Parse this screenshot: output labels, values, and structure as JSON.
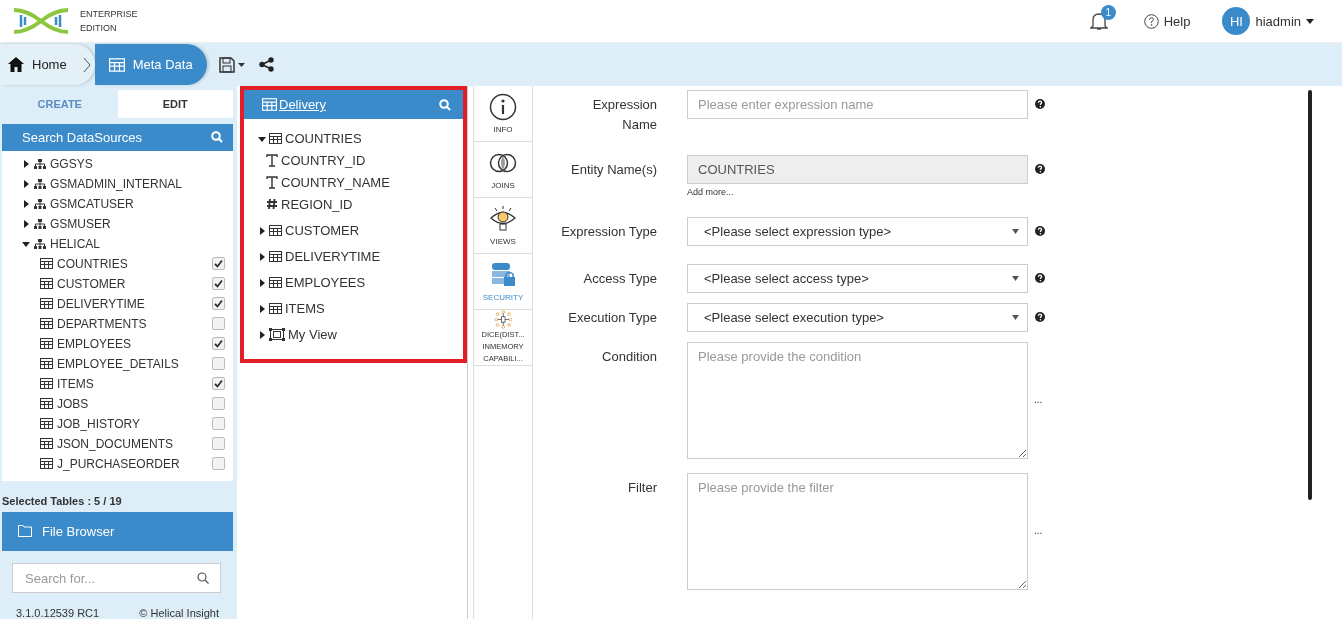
{
  "header": {
    "logo_lines": [
      "ENTERPRISE",
      "EDITION"
    ],
    "notification_count": "1",
    "help": "Help",
    "avatar_initials": "HI",
    "username": "hiadmin"
  },
  "breadcrumb": [
    {
      "label": "Home",
      "kind": "home",
      "selected": false
    },
    {
      "label": "Meta Data",
      "kind": "grid",
      "selected": true
    }
  ],
  "left_panel": {
    "tabs": [
      {
        "label": "CREATE",
        "selected": false
      },
      {
        "label": "EDIT",
        "selected": true
      }
    ],
    "search_title": "Search DataSources",
    "tree": [
      {
        "label": "GGSYS",
        "kind": "schema",
        "expanded": false
      },
      {
        "label": "GSMADMIN_INTERNAL",
        "kind": "schema",
        "expanded": false
      },
      {
        "label": "GSMCATUSER",
        "kind": "schema",
        "expanded": false
      },
      {
        "label": "GSMUSER",
        "kind": "schema",
        "expanded": false
      },
      {
        "label": "HELICAL",
        "kind": "schema",
        "expanded": true,
        "children": [
          {
            "label": "COUNTRIES",
            "kind": "table",
            "checked": true
          },
          {
            "label": "CUSTOMER",
            "kind": "table",
            "checked": true
          },
          {
            "label": "DELIVERYTIME",
            "kind": "table",
            "checked": true
          },
          {
            "label": "DEPARTMENTS",
            "kind": "table",
            "checked": false
          },
          {
            "label": "EMPLOYEES",
            "kind": "table",
            "checked": true
          },
          {
            "label": "EMPLOYEE_DETAILS",
            "kind": "table",
            "checked": false
          },
          {
            "label": "ITEMS",
            "kind": "table",
            "checked": true
          },
          {
            "label": "JOBS",
            "kind": "table",
            "checked": false
          },
          {
            "label": "JOB_HISTORY",
            "kind": "table",
            "checked": false
          },
          {
            "label": "JSON_DOCUMENTS",
            "kind": "table",
            "checked": false
          },
          {
            "label": "J_PURCHASEORDER",
            "kind": "table",
            "checked": false
          }
        ]
      }
    ],
    "selected_tables": "Selected Tables : 5 / 19",
    "file_browser": "File Browser",
    "search_placeholder": "Search for...",
    "version": "3.1.0.12539 RC1",
    "copyright": "© Helical Insight"
  },
  "metadata_panel": {
    "title": "Delivery",
    "tree": [
      {
        "label": "COUNTRIES",
        "kind": "table",
        "expanded": true,
        "children": [
          {
            "label": "COUNTRY_ID",
            "kind": "text"
          },
          {
            "label": "COUNTRY_NAME",
            "kind": "text"
          },
          {
            "label": "REGION_ID",
            "kind": "number"
          }
        ]
      },
      {
        "label": "CUSTOMER",
        "kind": "table",
        "expanded": false
      },
      {
        "label": "DELIVERYTIME",
        "kind": "table",
        "expanded": false
      },
      {
        "label": "EMPLOYEES",
        "kind": "table",
        "expanded": false
      },
      {
        "label": "ITEMS",
        "kind": "table",
        "expanded": false
      },
      {
        "label": "My View",
        "kind": "view",
        "expanded": false
      }
    ]
  },
  "side_nav": [
    {
      "label": "INFO",
      "kind": "info",
      "selected": false
    },
    {
      "label": "JOINS",
      "kind": "joins",
      "selected": false
    },
    {
      "label": "VIEWS",
      "kind": "views",
      "selected": false
    },
    {
      "label": "SECURITY",
      "kind": "security",
      "selected": true
    },
    {
      "label": "DICE(DIST... INMEMORY CAPABILI...",
      "kind": "dice",
      "selected": false
    }
  ],
  "form": [
    {
      "label": "Expression Name",
      "kind": "text",
      "placeholder": "Please enter expression name"
    },
    {
      "label": "Entity Name(s)",
      "kind": "readonly",
      "value": "COUNTRIES",
      "note": "Add more..."
    },
    {
      "label": "Expression Type",
      "kind": "select",
      "value": "<Please select expression type>"
    },
    {
      "label": "Access Type",
      "kind": "select",
      "value": "<Please select access type>"
    },
    {
      "label": "Execution Type",
      "kind": "select",
      "value": "<Please select execution type>"
    },
    {
      "label": "Condition",
      "kind": "textarea",
      "placeholder": "Please provide the condition",
      "side_text": "..."
    },
    {
      "label": "Filter",
      "kind": "textarea",
      "placeholder": "Please provide the filter",
      "side_text": "..."
    }
  ]
}
